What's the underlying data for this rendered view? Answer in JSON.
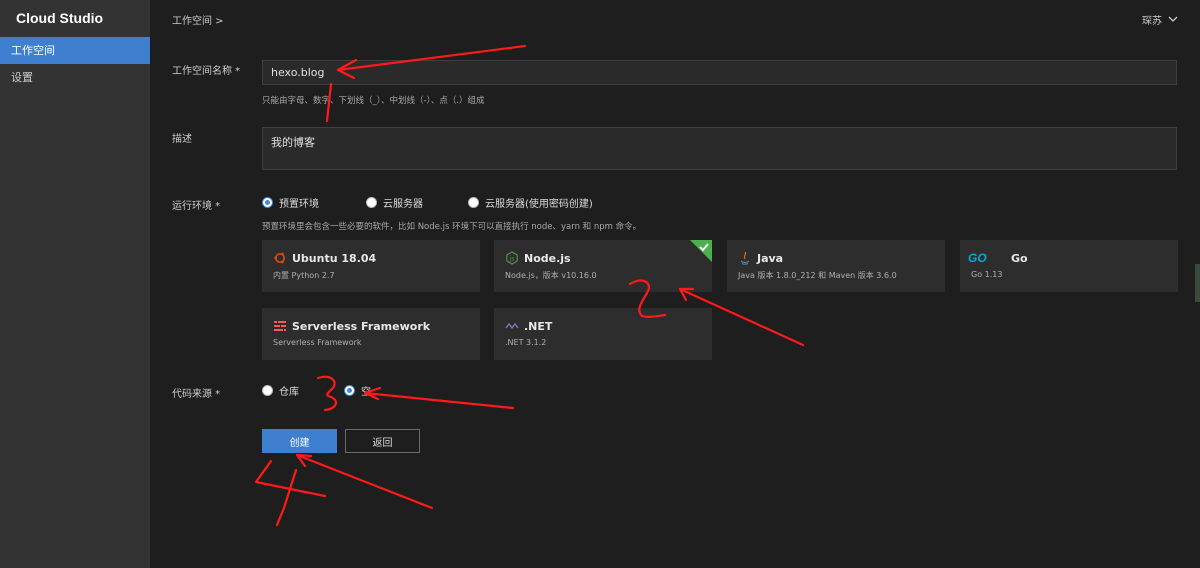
{
  "brand": "Cloud Studio",
  "sidebar": {
    "items": [
      {
        "label": "工作空间",
        "active": true
      },
      {
        "label": "设置",
        "active": false
      }
    ]
  },
  "header": {
    "breadcrumb": "工作空间 >",
    "user": "琛苏"
  },
  "form": {
    "name": {
      "label": "工作空间名称 *",
      "value": "hexo.blog",
      "hint": "只能由字母、数字、下划线（_）、中划线（-）、点（.）组成"
    },
    "description": {
      "label": "描述",
      "value": "我的博客"
    },
    "env": {
      "label": "运行环境 *",
      "options": [
        "预置环境",
        "云服务器",
        "云服务器(使用密码创建)"
      ],
      "selected": "预置环境",
      "hint": "预置环境里会包含一些必要的软件，比如 Node.js 环境下可以直接执行 node、yarn 和 npm 命令。"
    },
    "cards": [
      {
        "title": "Ubuntu 18.04",
        "sub": "内置 Python 2.7",
        "icon": "ubuntu-icon",
        "selected": false
      },
      {
        "title": "Node.js",
        "sub": "Node.js，版本 v10.16.0",
        "icon": "nodejs-icon",
        "selected": true
      },
      {
        "title": "Java",
        "sub": "Java 版本 1.8.0_212 和 Maven 版本 3.6.0",
        "icon": "java-icon",
        "selected": false
      },
      {
        "title": "Go",
        "sub": "Go 1.13",
        "icon": "go-icon",
        "icon_text": "GO",
        "selected": false
      },
      {
        "title": "Serverless Framework",
        "sub": "Serverless Framework",
        "icon": "serverless-icon",
        "selected": false
      },
      {
        "title": ".NET",
        "sub": ".NET 3.1.2",
        "icon": "dotnet-icon",
        "selected": false
      }
    ],
    "source": {
      "label": "代码来源 *",
      "options": [
        "仓库",
        "空"
      ],
      "selected": "空"
    },
    "buttons": {
      "create": "创建",
      "back": "返回"
    }
  },
  "annotations": {
    "numbers": [
      "1",
      "2",
      "3",
      "4"
    ],
    "color": "#ff1a1a"
  },
  "colors": {
    "accent": "#3f7fd0",
    "sidebar": "#333333",
    "background": "#1e1e1e",
    "card": "#2d2d2d",
    "selected_badge": "#4caf50"
  }
}
